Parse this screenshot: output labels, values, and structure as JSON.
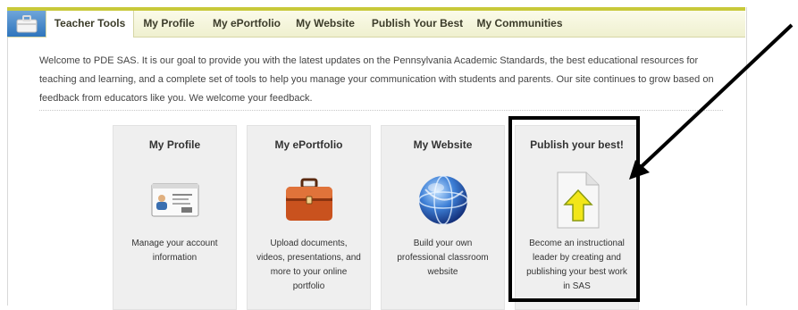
{
  "tabs": {
    "home_icon": "briefcase-icon",
    "items": [
      {
        "label": "Teacher Tools",
        "active": true
      },
      {
        "label": "My Profile"
      },
      {
        "label": "My ePortfolio"
      },
      {
        "label": "My Website"
      },
      {
        "label": "Publish Your Best"
      },
      {
        "label": "My Communities"
      }
    ]
  },
  "intro": {
    "text": "Welcome to PDE SAS. It is our goal to provide you with the latest updates on the Pennsylvania Academic Standards, the best educational resources for teaching and learning, and a complete set of tools to help you manage your communication with students and parents. Our site continues to grow based on feedback from educators like you. We welcome your feedback."
  },
  "cards": [
    {
      "title": "My Profile",
      "icon": "id-card-icon",
      "description": "Manage your account information"
    },
    {
      "title": "My ePortfolio",
      "icon": "briefcase-icon",
      "description": "Upload documents, videos, presentations, and more to your online portfolio"
    },
    {
      "title": "My Website",
      "icon": "globe-icon",
      "description": "Build your own professional classroom website"
    },
    {
      "title": "Publish your best!",
      "icon": "upload-document-icon",
      "description": "Become an instructional leader by creating and publishing your best work in SAS"
    }
  ],
  "colors": {
    "tab_bar_accent": "#c8c93a",
    "home_tab": "#2f75bd",
    "card_background": "#efefef",
    "annotation": "#000000"
  }
}
